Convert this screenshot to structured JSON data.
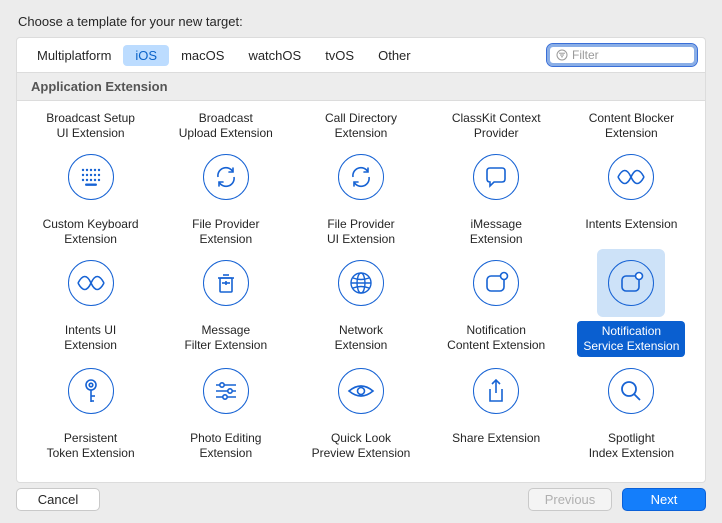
{
  "title": "Choose a template for your new target:",
  "tabs": [
    "Multiplatform",
    "iOS",
    "macOS",
    "watchOS",
    "tvOS",
    "Other"
  ],
  "selected_tab": "iOS",
  "filter_placeholder": "Filter",
  "section": "Application Extension",
  "templates": [
    {
      "label": "Broadcast Setup\nUI Extension",
      "icon": "",
      "selected": false,
      "toponly": true
    },
    {
      "label": "Broadcast\nUpload Extension",
      "icon": "",
      "selected": false,
      "toponly": true
    },
    {
      "label": "Call Directory\nExtension",
      "icon": "",
      "selected": false,
      "toponly": true
    },
    {
      "label": "ClassKit Context\nProvider",
      "icon": "",
      "selected": false,
      "toponly": true
    },
    {
      "label": "Content Blocker\nExtension",
      "icon": "",
      "selected": false,
      "toponly": true
    },
    {
      "label": "Custom Keyboard\nExtension",
      "icon": "keyboard",
      "selected": false
    },
    {
      "label": "File Provider\nExtension",
      "icon": "sync",
      "selected": false
    },
    {
      "label": "File Provider\nUI Extension",
      "icon": "sync",
      "selected": false
    },
    {
      "label": "iMessage\nExtension",
      "icon": "bubble",
      "selected": false
    },
    {
      "label": "Intents Extension",
      "icon": "wave",
      "selected": false
    },
    {
      "label": "Intents UI\nExtension",
      "icon": "wave",
      "selected": false
    },
    {
      "label": "Message\nFilter Extension",
      "icon": "trash",
      "selected": false
    },
    {
      "label": "Network\nExtension",
      "icon": "globe",
      "selected": false
    },
    {
      "label": "Notification\nContent Extension",
      "icon": "notification",
      "selected": false
    },
    {
      "label": "Notification\nService Extension",
      "icon": "notification",
      "selected": true
    },
    {
      "label": "Persistent\nToken Extension",
      "icon": "key",
      "selected": false
    },
    {
      "label": "Photo Editing\nExtension",
      "icon": "sliders",
      "selected": false
    },
    {
      "label": "Quick Look\nPreview Extension",
      "icon": "eye",
      "selected": false
    },
    {
      "label": "Share Extension",
      "icon": "share",
      "selected": false
    },
    {
      "label": "Spotlight\nIndex Extension",
      "icon": "search",
      "selected": false
    }
  ],
  "buttons": {
    "cancel": "Cancel",
    "previous": "Previous",
    "next": "Next"
  }
}
